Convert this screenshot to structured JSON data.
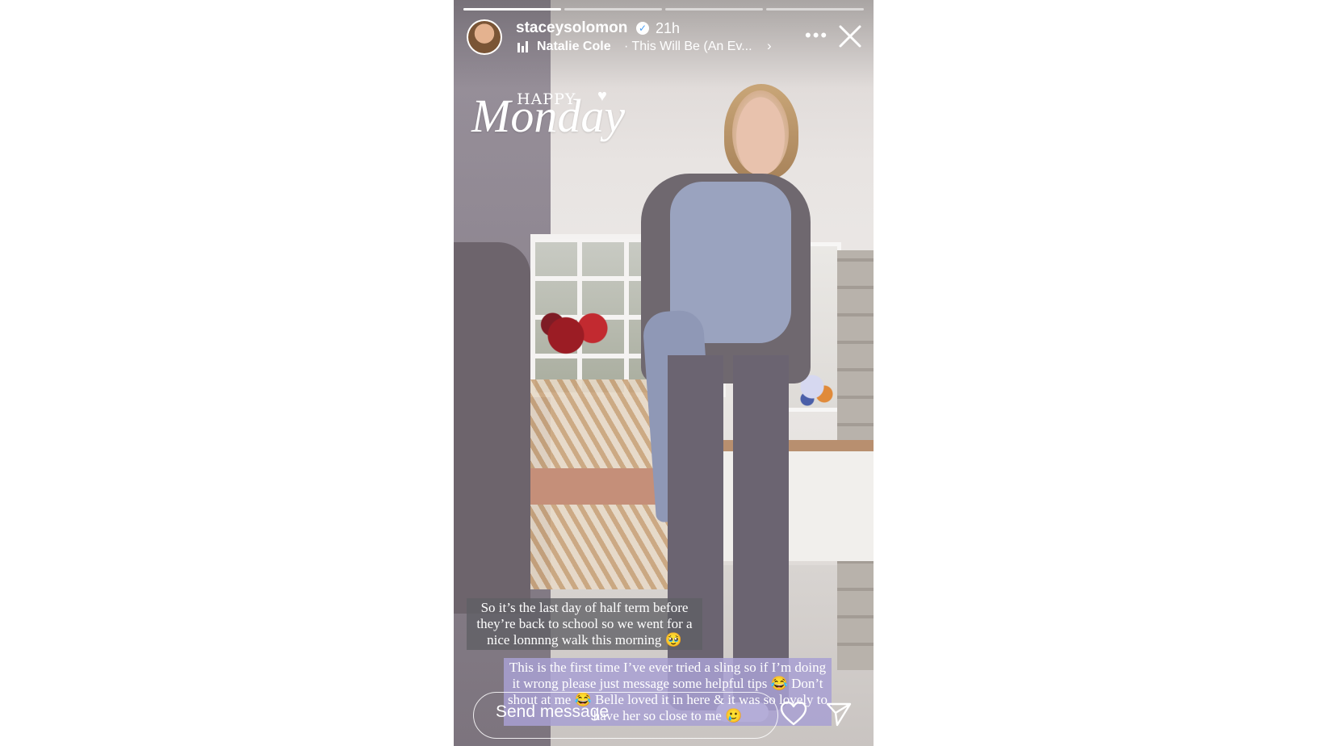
{
  "story": {
    "progress": [
      1,
      0,
      0,
      0
    ],
    "username": "staceysolomon",
    "posted": "21h",
    "music": {
      "artist": "Natalie Cole",
      "title": "· This Will Be (An Ev..."
    },
    "sticker_top": "HAPPY",
    "sticker_main": "Monday",
    "caption1": "So it’s the last day of half term before they’re back to school so we went for a nice lonnnng walk this morning 🥹",
    "caption2": "This is the first time I’ve ever tried a sling so if I’m doing it wrong please just message some helpful tips 😂 Don’t shout at me 😂 Belle loved it in here & it was so lovely to have her so close to me 🥲",
    "reply_placeholder": "Send message",
    "icons": {
      "verified": "verified-badge-icon",
      "more": "more-options-icon",
      "close": "close-icon",
      "like": "heart-icon",
      "share": "send-icon",
      "music": "music-bars-icon"
    }
  }
}
